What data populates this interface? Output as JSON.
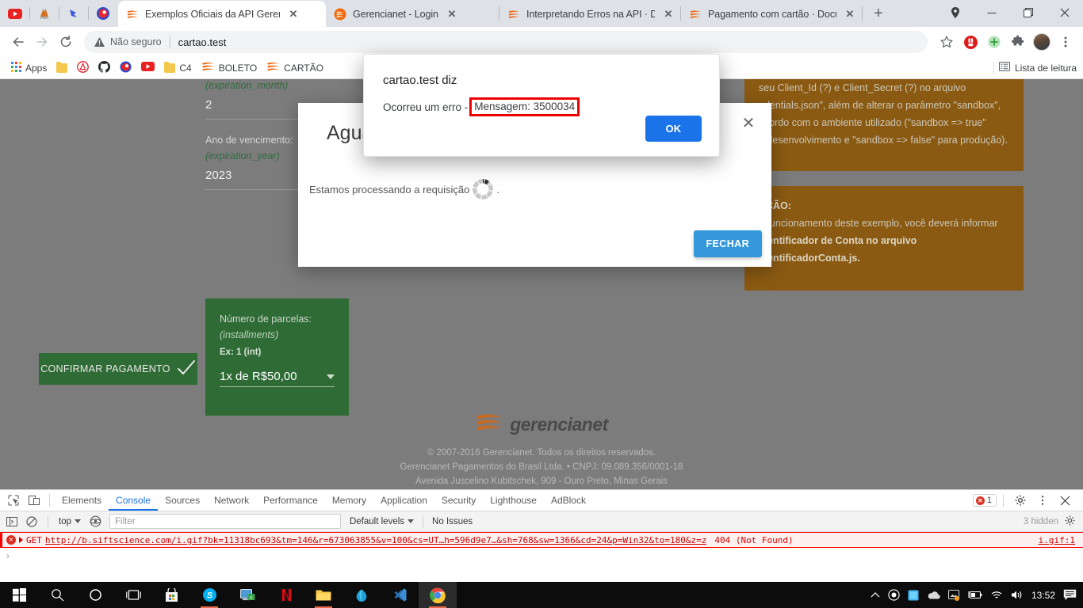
{
  "browser": {
    "pinned_tabs": [
      "youtube-pinned",
      "pma-pinned",
      "unknown-pinned",
      "avast-pinned"
    ],
    "tabs": [
      {
        "title": "Exemplos Oficiais da API Gerenci",
        "active": true,
        "favicon": "gerencianet-icon"
      },
      {
        "title": "Gerencianet - Login",
        "active": false,
        "favicon": "gerencianet-circle-icon"
      },
      {
        "title": "Interpretando Erros na API · Doc",
        "active": false,
        "favicon": "gerencianet-icon"
      },
      {
        "title": "Pagamento com cartão · Docum",
        "active": false,
        "favicon": "gerencianet-icon"
      }
    ],
    "new_tab_label": "+",
    "window_controls": {
      "minimize": "—",
      "maximize": "▢",
      "close": "✕"
    },
    "omnibox": {
      "security_label": "Não seguro",
      "url": "cartao.test"
    },
    "toolbar_icons": [
      "star-icon",
      "adblock-icon",
      "extension-add-icon",
      "extensions-puzzle-icon",
      "profile-avatar",
      "chrome-menu-icon"
    ],
    "bookmarks": [
      {
        "label": "Apps",
        "icon": "apps-grid-icon"
      },
      {
        "label": "",
        "icon": "folder-icon"
      },
      {
        "label": "",
        "icon": "avast-icon"
      },
      {
        "label": "",
        "icon": "github-icon"
      },
      {
        "label": "",
        "icon": "avast-secure-browser-icon"
      },
      {
        "label": "",
        "icon": "youtube-icon"
      },
      {
        "label": "C4",
        "icon": "folder-icon"
      },
      {
        "label": "BOLETO",
        "icon": "gerencianet-icon"
      },
      {
        "label": "CARTÃO",
        "icon": "gerencianet-icon"
      }
    ],
    "reading_list_label": "Lista de leitura"
  },
  "page": {
    "fields": [
      {
        "label": "",
        "code": "(expiration_month)",
        "value": "2"
      },
      {
        "label": "Ano de vencimento:",
        "code": "(expiration_year)",
        "value": "2023"
      }
    ],
    "installments_card": {
      "label": "Número de parcelas:",
      "code": "(installments)",
      "example": "Ex: 1 (int)",
      "selected": "1x de R$50,00"
    },
    "confirm_button": "CONFIRMAR PAGAMENTO",
    "notice_1": [
      "seu Client_Id (?) e Client_Secret (?) no arquivo",
      "edentials.json\", além de alterar o parâmetro \"sandbox\",",
      "acordo com o ambiente utilizado (\"sandbox => true\"",
      "a desenvolvimento e \"sandbox => false\" para produção)."
    ],
    "notice_2": [
      "NÇÃO:",
      "a funcionamento deste exemplo, você deverá informar",
      "Identificador de Conta no arquivo",
      "IdentificadorConta.js."
    ],
    "footer": {
      "brand": "gerencianet",
      "lines": [
        "© 2007-2016 Gerencianet. Todos os direitos reservados.",
        "Gerencianet Pagamentos do Brasil Ltda. • CNPJ: 09.089.356/0001-18",
        "Avenida Juscelino Kubitschek, 909 - Ouro Preto, Minas Gerais"
      ]
    }
  },
  "modal": {
    "title": "Aguarde",
    "body_text": "Estamos processando a requisição",
    "body_suffix": ".",
    "close_icon": "close-icon",
    "footer_button": "FECHAR"
  },
  "alert": {
    "title": "cartao.test diz",
    "message_prefix": "Ocorreu um erro -",
    "message_highlight": "Mensagem: 3500034",
    "ok_button": "OK",
    "highlight_color": "#ee0000"
  },
  "devtools": {
    "tabs": [
      "Elements",
      "Console",
      "Sources",
      "Network",
      "Performance",
      "Memory",
      "Application",
      "Security",
      "Lighthouse",
      "AdBlock"
    ],
    "active_tab": "Console",
    "error_count": "1",
    "context": "top",
    "filter_placeholder": "Filter",
    "levels_label": "Default levels",
    "issues_label": "No Issues",
    "hidden_label": "3 hidden",
    "console_entry": {
      "method": "GET",
      "url": "http://b.siftscience.com/i.gif?bk=11318bc693&tm=146&r=673063855&v=100&cs=UT…h=596d9e7…&sh=768&sw=1366&cd=24&p=Win32&to=180&z=z",
      "status": "404 (Not Found)",
      "source": "i.gif:1"
    },
    "prompt": "›"
  },
  "taskbar": {
    "items": [
      "start-windows-icon",
      "search-icon",
      "cortana-icon",
      "task-view-icon",
      "microsoft-store-icon",
      "skype-icon",
      "remote-desktop-icon",
      "netflix-icon",
      "file-explorer-icon",
      "acrobat-icon",
      "vscode-icon",
      "chrome-icon"
    ],
    "tray": [
      "show-hidden-icons",
      "record-icon",
      "app-blue-icon",
      "onedrive-icon",
      "photo-app-icon",
      "battery-saver-icon",
      "wifi-icon",
      "volume-icon"
    ],
    "clock": "13:52",
    "notification_icon": "action-center-icon"
  }
}
